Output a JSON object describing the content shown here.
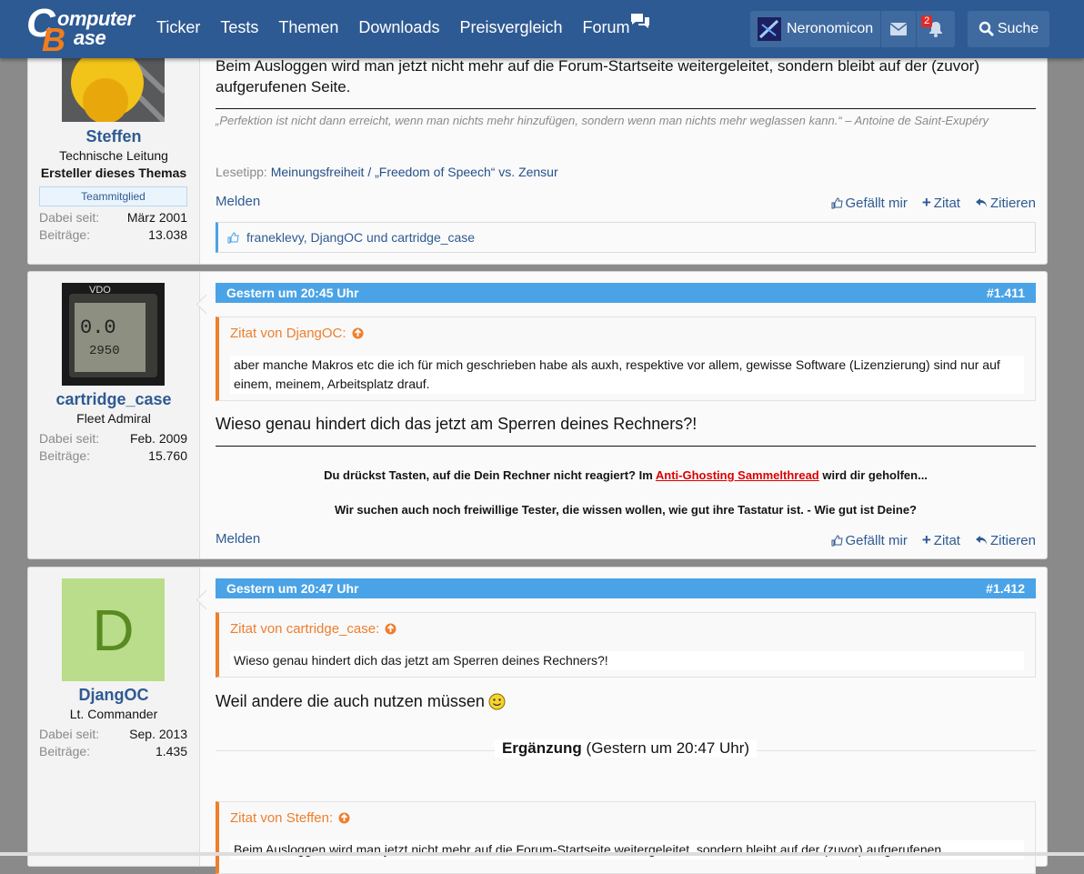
{
  "header": {
    "logo_line1": "omputer",
    "logo_line2": "ase",
    "nav": [
      "Ticker",
      "Tests",
      "Themen",
      "Downloads",
      "Preisvergleich",
      "Forum"
    ],
    "username": "Neronomicon",
    "notif_count": "2",
    "search_label": "Suche"
  },
  "post1": {
    "username": "Steffen",
    "title": "Technische Leitung",
    "creator": "Ersteller dieses Themas",
    "team_badge": "Teammitglied",
    "joined_label": "Dabei seit:",
    "joined": "März 2001",
    "posts_label": "Beiträge:",
    "posts": "13.038",
    "body": "Beim Ausloggen wird man jetzt nicht mehr auf die Forum-Startseite weitergeleitet, sondern bleibt auf der (zuvor) aufgerufenen Seite.",
    "quote_sig": "„Perfektion ist nicht dann erreicht, wenn man nichts mehr hinzufügen, sondern wenn man nichts mehr weglassen kann.“ – Antoine de Saint-Exupéry",
    "lesetipp_label": "Lesetipp:",
    "lesetipp_link": "Meinungsfreiheit / „Freedom of Speech“ vs. Zensur",
    "report": "Melden",
    "like": "Gefällt mir",
    "zitat": "Zitat",
    "zitieren": "Zitieren",
    "likes_text": "franeklevy, DjangOC und cartridge_case"
  },
  "post2": {
    "username": "cartridge_case",
    "title": "Fleet Admiral",
    "joined_label": "Dabei seit:",
    "joined": "Feb. 2009",
    "posts_label": "Beiträge:",
    "posts": "15.760",
    "date": "Gestern um 20:45 Uhr",
    "number": "#1.411",
    "quote_head": "Zitat von DjangOC:",
    "quote_body": "aber manche Makros etc die ich für mich geschrieben habe als auxh, respektive vor allem, gewisse Software (Lizenzierung) sind nur auf einem, meinem, Arbeitsplatz drauf.",
    "body": "Wieso genau hindert dich das jetzt am Sperren deines Rechners?!",
    "sig1_a": "Du drückst Tasten, auf die Dein Rechner nicht reagiert? Im ",
    "sig1_link": "Anti-Ghosting Sammelthread",
    "sig1_b": " wird dir geholfen...",
    "sig2": "Wir suchen auch noch freiwillige Tester, die wissen wollen, wie gut ihre Tastatur ist. - Wie gut ist Deine?",
    "report": "Melden",
    "like": "Gefällt mir",
    "zitat": "Zitat",
    "zitieren": "Zitieren"
  },
  "post3": {
    "username": "DjangOC",
    "avatar_letter": "D",
    "title": "Lt. Commander",
    "joined_label": "Dabei seit:",
    "joined": "Sep. 2013",
    "posts_label": "Beiträge:",
    "posts": "1.435",
    "date": "Gestern um 20:47 Uhr",
    "number": "#1.412",
    "quote_head": "Zitat von cartridge_case:",
    "quote_body": "Wieso genau hindert dich das jetzt am Sperren deines Rechners?!",
    "body": "Weil andere die auch nutzen müssen",
    "addition_bold": "Ergänzung",
    "addition_time": "(Gestern um 20:47 Uhr)",
    "quote2_head": "Zitat von Steffen:",
    "quote2_body": "Beim Ausloggen wird man jetzt nicht mehr auf die Forum-Startseite weitergeleitet, sondern bleibt auf der (zuvor) aufgerufenen"
  },
  "colors": {
    "header": "#2e5a93",
    "accent": "#4aa3e6",
    "quote": "#ee7f2d"
  }
}
